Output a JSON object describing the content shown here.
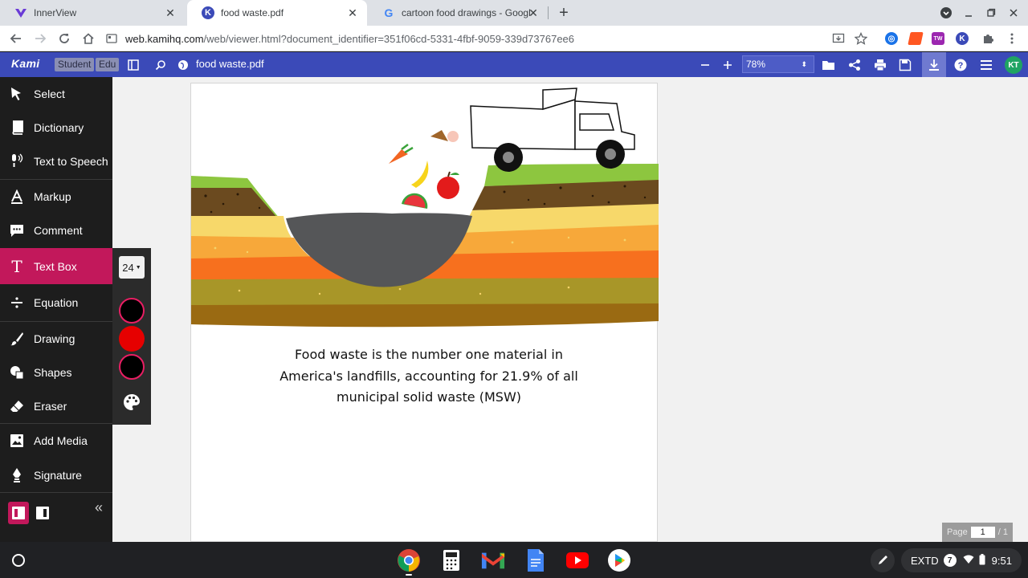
{
  "browser": {
    "tabs": [
      {
        "title": "InnerView",
        "active": false
      },
      {
        "title": "food waste.pdf",
        "active": true
      },
      {
        "title": "cartoon food drawings - Google",
        "active": false
      }
    ],
    "new_tab": "+",
    "url_host": "web.kamihq.com",
    "url_path": "/web/viewer.html?document_identifier=351f06cd-5331-4fbf-9059-339d73767ee6"
  },
  "kami": {
    "logo": "Kami",
    "badge_student": "Student",
    "badge_edu": "Edu",
    "document_name": "food waste.pdf",
    "zoom": "78%",
    "avatar_initials": "KT",
    "brand_color": "#3b4ab8"
  },
  "sidebar": {
    "items": [
      {
        "label": "Select",
        "icon": "cursor-arrow-icon"
      },
      {
        "label": "Dictionary",
        "icon": "book-icon"
      },
      {
        "label": "Text to Speech",
        "icon": "speech-icon"
      },
      {
        "label": "Markup",
        "icon": "markup-icon"
      },
      {
        "label": "Comment",
        "icon": "comment-icon"
      },
      {
        "label": "Text Box",
        "icon": "text-t-icon",
        "active": true
      },
      {
        "label": "Equation",
        "icon": "divide-icon"
      },
      {
        "label": "Drawing",
        "icon": "brush-icon"
      },
      {
        "label": "Shapes",
        "icon": "shapes-icon"
      },
      {
        "label": "Eraser",
        "icon": "eraser-icon"
      },
      {
        "label": "Add Media",
        "icon": "image-icon"
      },
      {
        "label": "Signature",
        "icon": "pen-nib-icon"
      }
    ],
    "collapse": "«",
    "active_color": "#c2185b"
  },
  "textbox_panel": {
    "font_size": "24",
    "colors": [
      "#000000",
      "#e60000",
      "#000000"
    ]
  },
  "document": {
    "caption_lines": [
      "Food waste is the number one material in",
      "America's landfills, accounting for 21.9% of all",
      "municipal solid waste (MSW)"
    ]
  },
  "pager": {
    "label": "Page",
    "current": "1",
    "total": "/ 1"
  },
  "shelf": {
    "apps": [
      "Chrome",
      "Calculator",
      "Gmail",
      "Docs",
      "YouTube",
      "Play Store"
    ],
    "tray_text": "EXTD",
    "notification_count": "7",
    "time": "9:51"
  }
}
